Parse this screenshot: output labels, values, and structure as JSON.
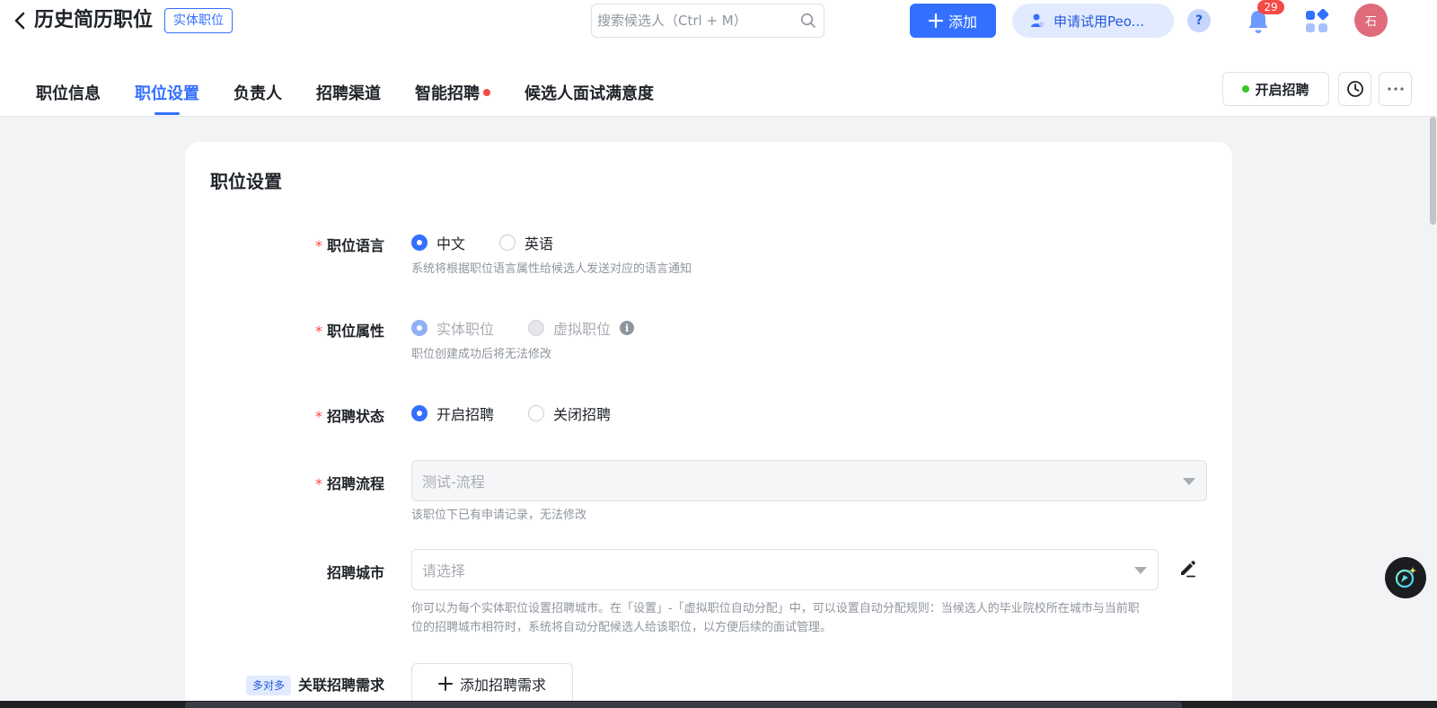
{
  "header": {
    "title": "历史简历职位",
    "title_tag": "实体职位",
    "search_placeholder": "搜索候选人（Ctrl + M）",
    "add_label": "添加",
    "trial_label": "申请试用Peo...",
    "help_label": "?",
    "notification_count": "29",
    "avatar_text": "石"
  },
  "tabs": [
    {
      "label": "职位信息",
      "active": false
    },
    {
      "label": "职位设置",
      "active": true
    },
    {
      "label": "负责人",
      "active": false
    },
    {
      "label": "招聘渠道",
      "active": false
    },
    {
      "label": "智能招聘",
      "active": false,
      "dot": true
    },
    {
      "label": "候选人面试满意度",
      "active": false
    }
  ],
  "actions": {
    "open_recruit_label": "开启招聘"
  },
  "card": {
    "title": "职位设置",
    "language": {
      "label": "职位语言",
      "options": [
        "中文",
        "英语"
      ],
      "selected": "中文",
      "hint": "系统将根据职位语言属性给候选人发送对应的语言通知"
    },
    "attribute": {
      "label": "职位属性",
      "options": [
        "实体职位",
        "虚拟职位"
      ],
      "selected": "实体职位",
      "hint": "职位创建成功后将无法修改"
    },
    "status": {
      "label": "招聘状态",
      "options": [
        "开启招聘",
        "关闭招聘"
      ],
      "selected": "开启招聘"
    },
    "process": {
      "label": "招聘流程",
      "value": "测试-流程",
      "hint": "该职位下已有申请记录，无法修改"
    },
    "city": {
      "label": "招聘城市",
      "placeholder": "请选择",
      "hint_line1": "你可以为每个实体职位设置招聘城市。在「设置」-「虚拟职位自动分配」中，可以设置自动分配规则：当候选人的毕业院校所在城市与当前职",
      "hint_line2": "位的招聘城市相符时，系统将自动分配候选人给该职位，以方便后续的面试管理。"
    },
    "demand": {
      "tag": "多对多",
      "label": "关联招聘需求",
      "button_label": "添加招聘需求"
    }
  },
  "colors": {
    "primary": "#3370ff",
    "required": "#f54a45",
    "success": "#34c724"
  }
}
